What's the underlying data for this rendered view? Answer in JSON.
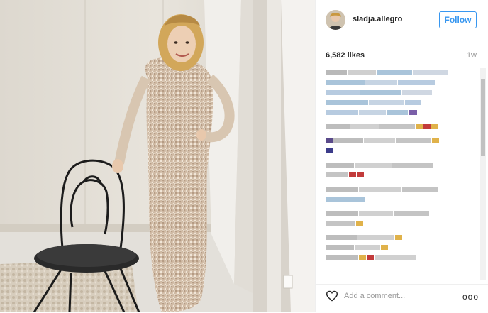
{
  "post": {
    "username": "sladja.allegro",
    "follow_label": "Follow",
    "likes": "6,582 likes",
    "age": "1w",
    "add_comment_placeholder": "Add a comment...",
    "more_label": "ooo"
  },
  "icons": {
    "heart": "heart-icon",
    "avatar": "avatar",
    "more": "more-options-icon"
  },
  "colors": {
    "accent": "#3897f0",
    "text": "#262626",
    "muted": "#999999"
  }
}
